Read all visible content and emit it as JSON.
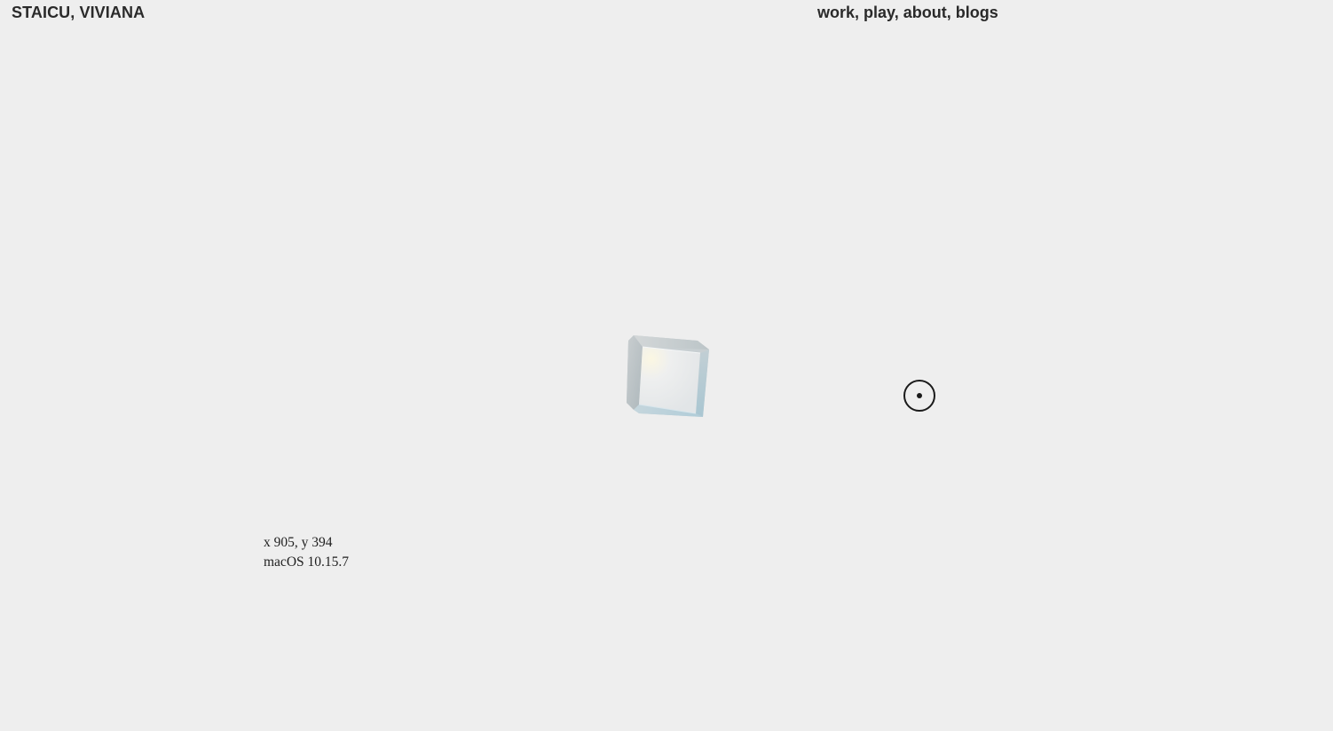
{
  "header": {
    "site_name": "STAICU, VIVIANA"
  },
  "nav": {
    "items": [
      {
        "label": "work",
        "sep": ","
      },
      {
        "label": "play",
        "sep": ","
      },
      {
        "label": "about",
        "sep": ","
      },
      {
        "label": "blogs",
        "sep": ""
      }
    ]
  },
  "info": {
    "coords": "x 905, y 394",
    "os": "macOS 10.15.7"
  },
  "colors": {
    "background": "#eeeeee",
    "text": "#2a2a2a"
  },
  "icons": {
    "cube": "glass-cube-3d",
    "cursor": "circle-dot-cursor"
  }
}
